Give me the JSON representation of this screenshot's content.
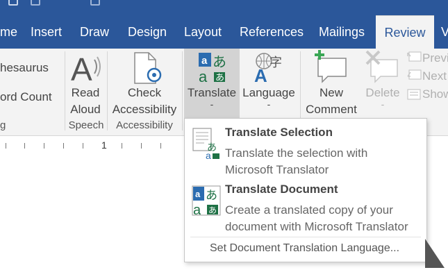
{
  "tabs": [
    {
      "label": "me",
      "active": false
    },
    {
      "label": "Insert",
      "active": false
    },
    {
      "label": "Draw",
      "active": false
    },
    {
      "label": "Design",
      "active": false
    },
    {
      "label": "Layout",
      "active": false
    },
    {
      "label": "References",
      "active": false
    },
    {
      "label": "Mailings",
      "active": false
    },
    {
      "label": "Review",
      "active": true
    },
    {
      "label": "V",
      "active": false
    }
  ],
  "ribbon": {
    "proofing": {
      "thesaurus": "hesaurus",
      "word_count": "ord Count",
      "group_label": "g"
    },
    "speech": {
      "read_aloud_line1": "Read",
      "read_aloud_line2": "Aloud",
      "group_label": "Speech"
    },
    "accessibility": {
      "check_line1": "Check",
      "check_line2": "Accessibility",
      "group_label": "Accessibility"
    },
    "language": {
      "translate": "Translate",
      "translate_dropdown": "-",
      "language": "Language",
      "language_dropdown": "-"
    },
    "comments": {
      "new_comment_line1": "New",
      "new_comment_line2": "Comment",
      "delete": "Delete",
      "delete_dropdown": "-",
      "previous": "Previ",
      "next": "Next",
      "show": "Show"
    }
  },
  "ruler": {
    "number": "1"
  },
  "menu": {
    "translate_selection": {
      "title": "Translate Selection",
      "desc_line1": "Translate the selection with",
      "desc_line2": "Microsoft Translator"
    },
    "translate_document": {
      "title": "Translate Document",
      "desc_line1": "Create a translated copy of your",
      "desc_line2": "document with Microsoft Translator"
    },
    "set_language": "Set Document Translation Language..."
  },
  "colors": {
    "accent": "#2b579a",
    "ribbon_bg": "#f3f3f3",
    "translate_green": "#1e7145",
    "translate_blue": "#2b6cb0"
  },
  "icons": [
    "read-aloud-icon",
    "accessibility-check-icon",
    "translate-icon",
    "language-icon",
    "new-comment-icon",
    "delete-comment-icon",
    "previous-comment-icon",
    "next-comment-icon",
    "show-comments-icon",
    "translate-selection-icon",
    "translate-document-icon"
  ]
}
